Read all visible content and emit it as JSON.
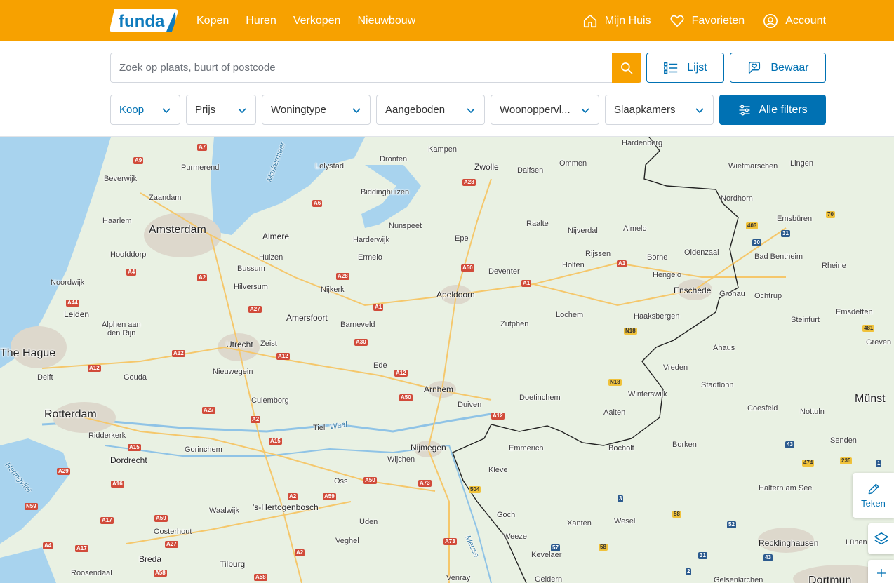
{
  "header": {
    "logo_text": "funda",
    "nav": [
      "Kopen",
      "Huren",
      "Verkopen",
      "Nieuwbouw"
    ],
    "mijn_huis": "Mijn Huis",
    "favorieten": "Favorieten",
    "account": "Account"
  },
  "search": {
    "placeholder": "Zoek op plaats, buurt of postcode",
    "value": "",
    "list_label": "Lijst",
    "save_label": "Bewaar"
  },
  "filters": {
    "koop": "Koop",
    "prijs": "Prijs",
    "woningtype": "Woningtype",
    "aangeboden": "Aangeboden",
    "woonoppervlakte": "Woonoppervl...",
    "slaapkamers": "Slaapkamers",
    "alle_filters": "Alle filters"
  },
  "map": {
    "draw_label": "Teken",
    "places": {
      "hardenberg": "Hardenberg",
      "kampen": "Kampen",
      "dronten": "Dronten",
      "zwolle": "Zwolle",
      "dalfsen": "Dalfsen",
      "ommen": "Ommen",
      "wietmarschen": "Wietmarschen",
      "lingen": "Lingen",
      "lelystad": "Lelystad",
      "markermeer": "Markermeer",
      "purmerend": "Purmerend",
      "beverwijk": "Beverwijk",
      "zaandam": "Zaandam",
      "haarlem": "Haarlem",
      "amsterdam": "Amsterdam",
      "almere": "Almere",
      "biddinghuizen": "Biddinghuizen",
      "nordhorn": "Nordhorn",
      "emsburen": "Emsbüren",
      "nunspeet": "Nunspeet",
      "raalte": "Raalte",
      "nijverdal": "Nijverdal",
      "almelo": "Almelo",
      "hoofddorp": "Hoofddorp",
      "harderwijk": "Harderwijk",
      "epe": "Epe",
      "oldenzaal": "Oldenzaal",
      "huizen": "Huizen",
      "ermelo": "Ermelo",
      "rijssen": "Rijssen",
      "bad_bentheim": "Bad Bentheim",
      "bussum": "Bussum",
      "deventer": "Deventer",
      "holten": "Holten",
      "borne": "Borne",
      "hengelo": "Hengelo",
      "rheine": "Rheine",
      "noordwijk": "Noordwijk",
      "hilversum": "Hilversum",
      "nijkerk": "Nijkerk",
      "enschede": "Enschede",
      "gronau": "Gronau",
      "ochtrup": "Ochtrup",
      "apeldoorn": "Apeldoorn",
      "leiden": "Leiden",
      "amersfoort": "Amersfoort",
      "lochem": "Lochem",
      "haaksbergen": "Haaksbergen",
      "emsdetten": "Emsdetten",
      "alphen": "Alphen aan",
      "alphen2": "den Rijn",
      "barneveld": "Barneveld",
      "zutphen": "Zutphen",
      "steinfurt": "Steinfurt",
      "the_hague": "The Hague",
      "utrecht": "Utrecht",
      "zeist": "Zeist",
      "ahaus": "Ahaus",
      "greven": "Greven",
      "delft": "Delft",
      "ede": "Ede",
      "vreden": "Vreden",
      "nieuwegein": "Nieuwegein",
      "gouda": "Gouda",
      "arnhem": "Arnhem",
      "stadtlohn": "Stadtlohn",
      "doetinchem": "Doetinchem",
      "winterswijk": "Winterswijk",
      "rotterdam": "Rotterdam",
      "culemborg": "Culemborg",
      "duiven": "Duiven",
      "aalten": "Aalten",
      "coesfeld": "Coesfeld",
      "nottuln": "Nottuln",
      "munster": "Münst",
      "tiel": "Tiel",
      "waal": "Waal",
      "ridderkerk": "Ridderkerk",
      "gorinchem": "Gorinchem",
      "nijmegen": "Nijmegen",
      "emmerich": "Emmerich",
      "bocholt": "Bocholt",
      "borken": "Borken",
      "senden": "Senden",
      "dordrecht": "Dordrecht",
      "wijchen": "Wijchen",
      "kleve": "Kleve",
      "haringvliet": "Haringvliet",
      "oss": "Oss",
      "haltern": "Haltern am See",
      "s_hertogenbosch": "'s-Hertogenbosch",
      "waalwijk": "Waalwijk",
      "goch": "Goch",
      "wesel": "Wesel",
      "uden": "Uden",
      "oosterhout": "Oosterhout",
      "xanten": "Xanten",
      "veghel": "Veghel",
      "weeze": "Weeze",
      "recklinghausen": "Recklinghausen",
      "lunen": "Lünen",
      "maas": "Meuse",
      "breda": "Breda",
      "kevelaer": "Kevelaer",
      "tilburg": "Tilburg",
      "roosendaal": "Roosendaal",
      "venray": "Venray",
      "geldern": "Geldern",
      "gelsenkirchen": "Gelsenkirchen",
      "dortmund": "Dortmun"
    },
    "roads": {
      "a7": "A7",
      "a9": "A9",
      "a6": "A6",
      "a28": "A28",
      "a28b": "A28",
      "a50": "A50",
      "a1a": "A1",
      "a1b": "A1",
      "a1c": "A1",
      "a4": "A4",
      "a2": "A2",
      "a44": "A44",
      "a27": "A27",
      "a30": "A30",
      "a12a": "A12",
      "a12b": "A12",
      "a12c": "A12",
      "a12d": "A12",
      "a12e": "A12",
      "a50b": "A50",
      "a27b": "A27",
      "a2b": "A2",
      "a15": "A15",
      "a15b": "A15",
      "a29": "A29",
      "a16": "A16",
      "a59": "A59",
      "a59b": "A59",
      "a2c": "A2",
      "a50c": "A50",
      "a73": "A73",
      "a73b": "A73",
      "n59": "N59",
      "a17": "A17",
      "a17b": "A17",
      "a4b": "A4",
      "a27c": "A27",
      "a2d": "A2",
      "a58": "A58",
      "a58b": "A58",
      "n18": "N18",
      "n18b": "N18",
      "r504": "504",
      "r403": "403",
      "r31": "31",
      "r30": "30",
      "r70": "70",
      "r481": "481",
      "r43": "43",
      "r474": "474",
      "r235": "235",
      "r1": "1",
      "r3": "3",
      "r58": "58",
      "r52": "52",
      "r57": "57",
      "r58b": "58",
      "r31b": "31",
      "r43b": "43",
      "r2": "2"
    }
  }
}
